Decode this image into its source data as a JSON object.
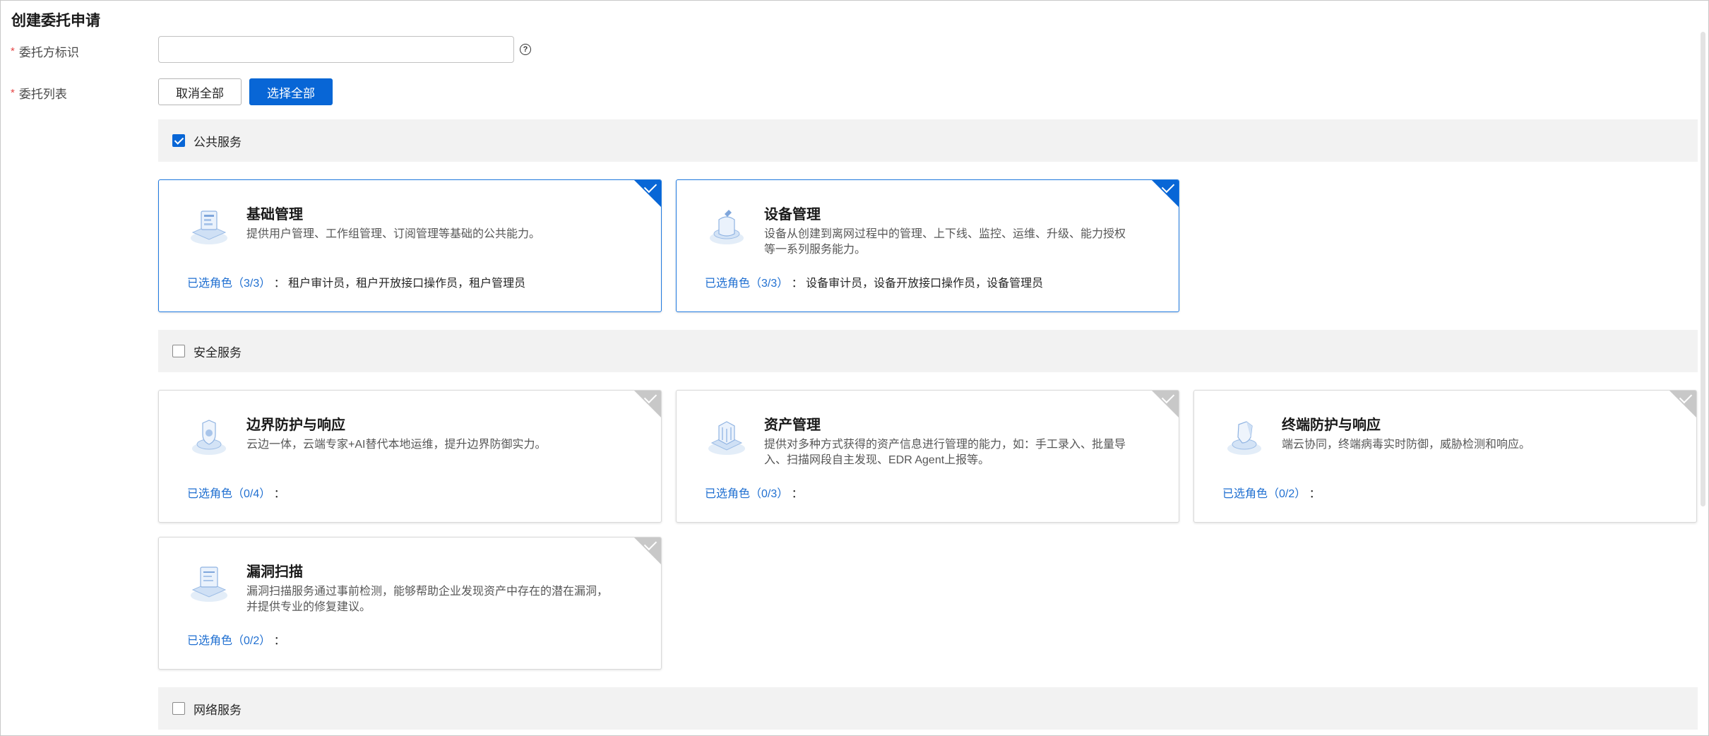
{
  "page": {
    "title": "创建委托申请"
  },
  "form": {
    "required_mark": "*",
    "delegate_id_label": "委托方标识",
    "delegate_id_value": "",
    "delegate_id_placeholder": "",
    "help_glyph": "?",
    "delegate_list_label": "委托列表",
    "cancel_all_label": "取消全部",
    "select_all_label": "选择全部"
  },
  "colors": {
    "primary": "#0866d6",
    "link": "#1f6fd1",
    "required": "#e54545",
    "group_bg": "#f2f2f2"
  },
  "groups": [
    {
      "label": "公共服务",
      "checked": true,
      "cards": [
        {
          "title": "基础管理",
          "desc": "提供用户管理、工作组管理、订阅管理等基础的公共能力。",
          "roles_label": "已选角色（3/3）",
          "roles_sep": "：",
          "roles": "租户审计员，租户开放接口操作员，租户管理员",
          "selected": true,
          "icon": "console-icon"
        },
        {
          "title": "设备管理",
          "desc": "设备从创建到离网过程中的管理、上下线、监控、运维、升级、能力授权等一系列服务能力。",
          "roles_label": "已选角色（3/3）",
          "roles_sep": "：",
          "roles": "设备审计员，设备开放接口操作员，设备管理员",
          "selected": true,
          "icon": "device-icon"
        }
      ]
    },
    {
      "label": "安全服务",
      "checked": false,
      "cards": [
        {
          "title": "边界防护与响应",
          "desc": "云边一体，云端专家+AI替代本地运维，提升边界防御实力。",
          "roles_label": "已选角色（0/4）",
          "roles_sep": "：",
          "roles": "",
          "selected": false,
          "icon": "shield-icon"
        },
        {
          "title": "资产管理",
          "desc": "提供对多种方式获得的资产信息进行管理的能力，如：手工录入、批量导入、扫描网段自主发现、EDR Agent上报等。",
          "roles_label": "已选角色（0/3）",
          "roles_sep": "：",
          "roles": "",
          "selected": false,
          "icon": "server-icon"
        },
        {
          "title": "终端防护与响应",
          "desc": "端云协同，终端病毒实时防御，威胁检测和响应。",
          "roles_label": "已选角色（0/2）",
          "roles_sep": "：",
          "roles": "",
          "selected": false,
          "icon": "terminal-shield-icon"
        },
        {
          "title": "漏洞扫描",
          "desc": "漏洞扫描服务通过事前检测，能够帮助企业发现资产中存在的潜在漏洞，并提供专业的修复建议。",
          "roles_label": "已选角色（0/2）",
          "roles_sep": "：",
          "roles": "",
          "selected": false,
          "icon": "scan-icon"
        }
      ]
    },
    {
      "label": "网络服务",
      "checked": false,
      "cards": []
    }
  ]
}
